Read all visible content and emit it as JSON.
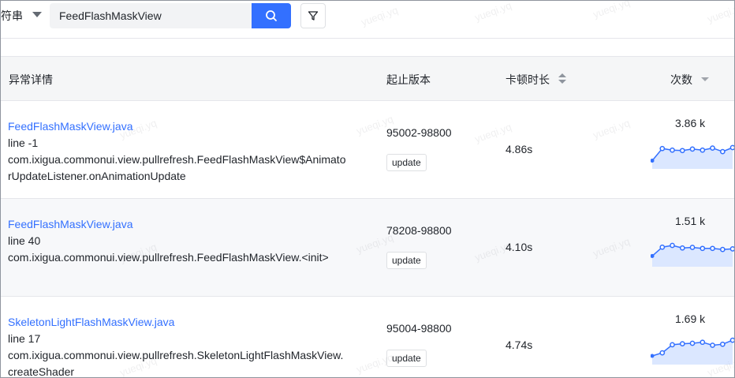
{
  "filter": {
    "type_label": "符串",
    "search_value": "FeedFlashMaskView"
  },
  "table": {
    "columns": {
      "detail": "异常详情",
      "version": "起止版本",
      "duration": "卡顿时长",
      "count": "次数"
    },
    "rows": [
      {
        "file": "FeedFlashMaskView.java",
        "line": "line -1",
        "code": "com.ixigua.commonui.view.pullrefresh.FeedFlashMaskView$AnimatorUpdateListener.onAnimationUpdate",
        "version": "95002-98800",
        "tag": "update",
        "duration": "4.86s",
        "count": "3.86 k",
        "trend": [
          0.2,
          0.68,
          0.62,
          0.6,
          0.66,
          0.62,
          0.7,
          0.56,
          0.72
        ]
      },
      {
        "file": "FeedFlashMaskView.java",
        "line": "line 40",
        "code": "com.ixigua.commonui.view.pullrefresh.FeedFlashMaskView.<init>",
        "version": "78208-98800",
        "tag": "update",
        "duration": "4.10s",
        "count": "1.51 k",
        "trend": [
          0.3,
          0.65,
          0.72,
          0.62,
          0.64,
          0.6,
          0.6,
          0.56,
          0.58
        ]
      },
      {
        "file": "SkeletonLightFlashMaskView.java",
        "line": "line 17",
        "code": "com.ixigua.commonui.view.pullrefresh.SkeletonLightFlashMaskView.createShader",
        "version": "95004-98800",
        "tag": "update",
        "duration": "4.74s",
        "count": "1.69 k",
        "trend": [
          0.22,
          0.34,
          0.66,
          0.7,
          0.72,
          0.76,
          0.64,
          0.68,
          0.84
        ]
      }
    ]
  },
  "watermark": "yueqi.yq",
  "colors": {
    "accent": "#3370ff",
    "spark_line": "#3370ff",
    "spark_fill": "#dbe7ff"
  }
}
